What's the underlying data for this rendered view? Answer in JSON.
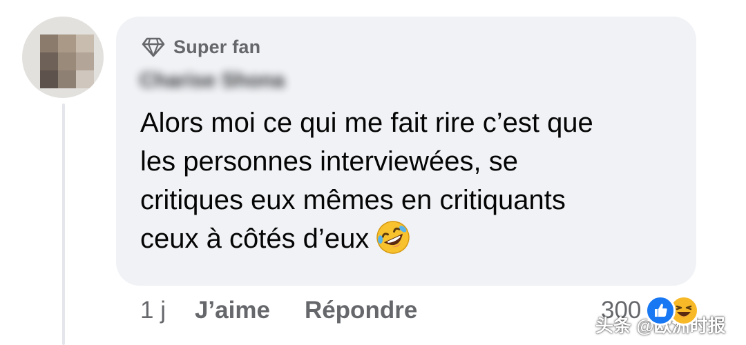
{
  "comment": {
    "badge": {
      "icon": "diamond-icon",
      "label": "Super fan"
    },
    "author": {
      "name": "Charise Shona"
    },
    "text_lines": [
      "Alors moi ce qui me fait rire c’est que",
      "les personnes interviewées, se",
      "critiques eux mêmes en critiquants",
      "ceux à côtés d’eux"
    ],
    "trailing_emoji": "rolling-on-floor-laughing-emoji"
  },
  "actions": {
    "time": "1 j",
    "like_label": "J’aime",
    "reply_label": "Répondre"
  },
  "reactions": {
    "count": "300",
    "types": [
      "like",
      "haha"
    ]
  },
  "watermark": "头条 @欧洲时报",
  "colors": {
    "bubble": "#f0f2f5",
    "secondary_text": "#65676b",
    "like_blue": "#1877f2",
    "haha_yellow": "#f7b928"
  }
}
